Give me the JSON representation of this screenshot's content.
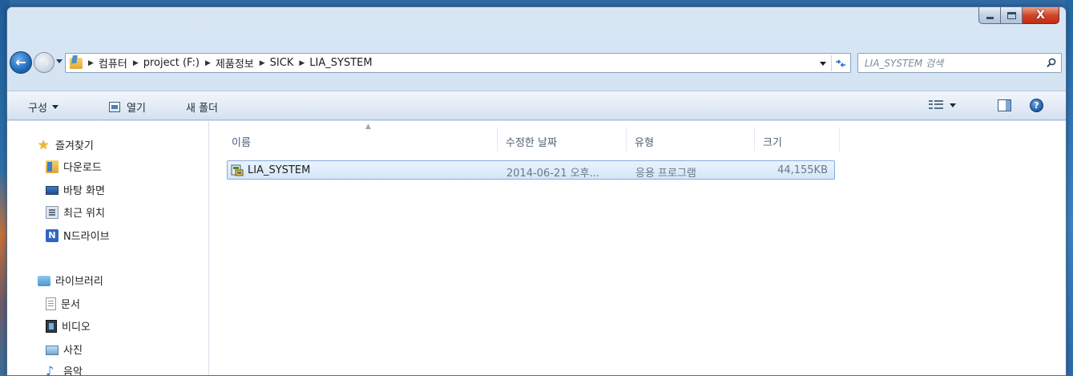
{
  "window": {
    "close_glyph": "X"
  },
  "address": {
    "crumbs": [
      "컴퓨터",
      "project (F:)",
      "제품정보",
      "SICK",
      "LIA_SYSTEM"
    ]
  },
  "search": {
    "placeholder": "LIA_SYSTEM 검색"
  },
  "toolbar": {
    "organize_label": "구성",
    "open_label": "열기",
    "new_folder_label": "새 폴더",
    "help_label": "?"
  },
  "sidebar": {
    "favorites": {
      "label": "즐겨찾기",
      "icon": "star-icon",
      "items": [
        {
          "label": "다운로드",
          "icon": "downloads-icon"
        },
        {
          "label": "바탕 화면",
          "icon": "desktop-icon"
        },
        {
          "label": "최근 위치",
          "icon": "recent-places-icon"
        },
        {
          "label": "N드라이브",
          "icon": "ndrive-icon",
          "glyph": "N"
        }
      ]
    },
    "libraries": {
      "label": "라이브러리",
      "icon": "library-icon",
      "items": [
        {
          "label": "문서",
          "icon": "documents-icon"
        },
        {
          "label": "비디오",
          "icon": "video-icon"
        },
        {
          "label": "사진",
          "icon": "pictures-icon"
        },
        {
          "label": "음악",
          "icon": "music-icon",
          "glyph": "♪"
        }
      ]
    }
  },
  "columns": {
    "name": "이름",
    "date": "수정한 날짜",
    "type": "유형",
    "size": "크기"
  },
  "files": [
    {
      "name": "LIA_SYSTEM",
      "date": "2014-06-21 오후...",
      "type": "응용 프로그램",
      "size": "44,155KB",
      "icon": "application-icon",
      "selected": true
    }
  ],
  "colors": {
    "selection_border": "#84acdd",
    "close_button": "#c02c12",
    "accent": "#2a73c8"
  }
}
